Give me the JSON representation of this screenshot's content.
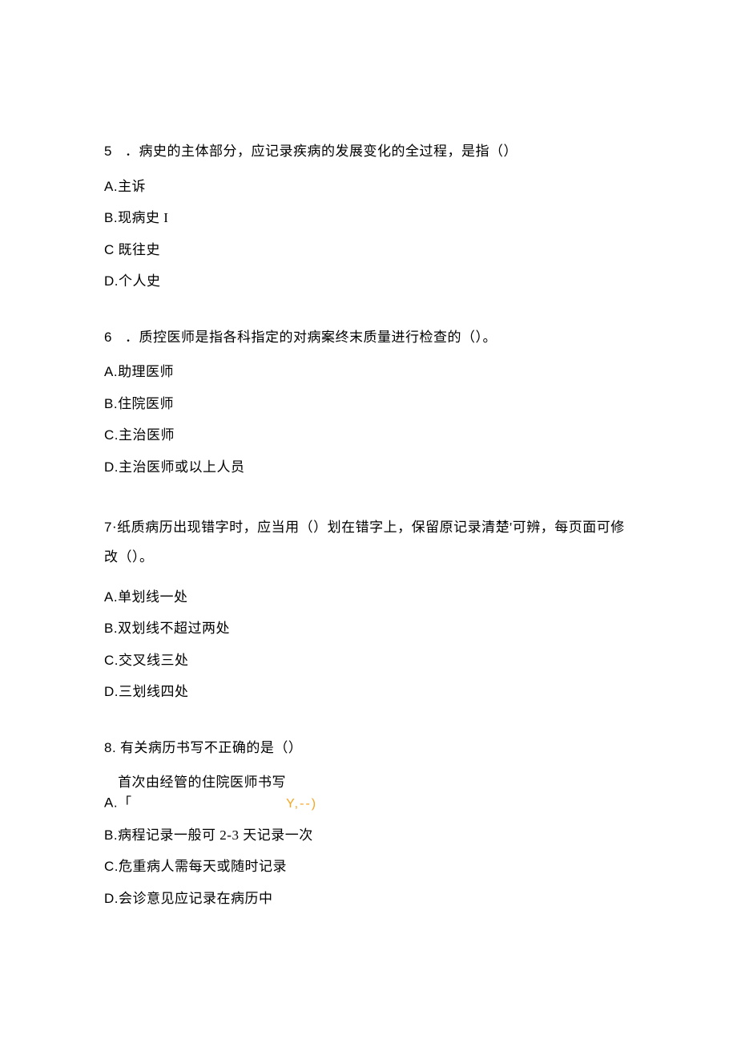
{
  "questions": [
    {
      "number": "5",
      "text": "．病史的主体部分，应记录疾病的发展变化的全过程，是指（）",
      "options": [
        {
          "label": "A.",
          "text": "主诉"
        },
        {
          "label": "B.",
          "text": "现病史 I"
        },
        {
          "label": "C",
          "text": " 既往史",
          "no_dot": true
        },
        {
          "label": "D.",
          "text": "个人史"
        }
      ]
    },
    {
      "number": "6",
      "text": "．质控医师是指各科指定的对病案终末质量进行检查的（）。",
      "options": [
        {
          "label": "A.",
          "text": "助理医师"
        },
        {
          "label": "B.",
          "text": "住院医师"
        },
        {
          "label": "C.",
          "text": "主治医师"
        },
        {
          "label": "D.",
          "text": "主治医师或以上人员"
        }
      ]
    },
    {
      "number": "7",
      "text": "·纸质病历出现错字时，应当用（）划在错字上，保留原记录清楚'可辨，每页面可修改（）。",
      "options": [
        {
          "label": "A.",
          "text": "单划线一处"
        },
        {
          "label": "B.",
          "text": "双划线不超过两处"
        },
        {
          "label": "C.",
          "text": "交叉线三处"
        },
        {
          "label": "D.",
          "text": "三划线四处"
        }
      ]
    },
    {
      "number": "8.",
      "text": " 有关病历书写不正确的是（）",
      "options": [
        {
          "label": "A.",
          "text": "首次由经管的住院医师书写「",
          "extra": "Y,--)"
        },
        {
          "label": "B.",
          "text": "病程记录一般可 2-3 天记录一次"
        },
        {
          "label": "C.",
          "text": "危重病人需每天或随时记录"
        },
        {
          "label": "D.",
          "text": "会诊意见应记录在病历中"
        }
      ]
    }
  ]
}
